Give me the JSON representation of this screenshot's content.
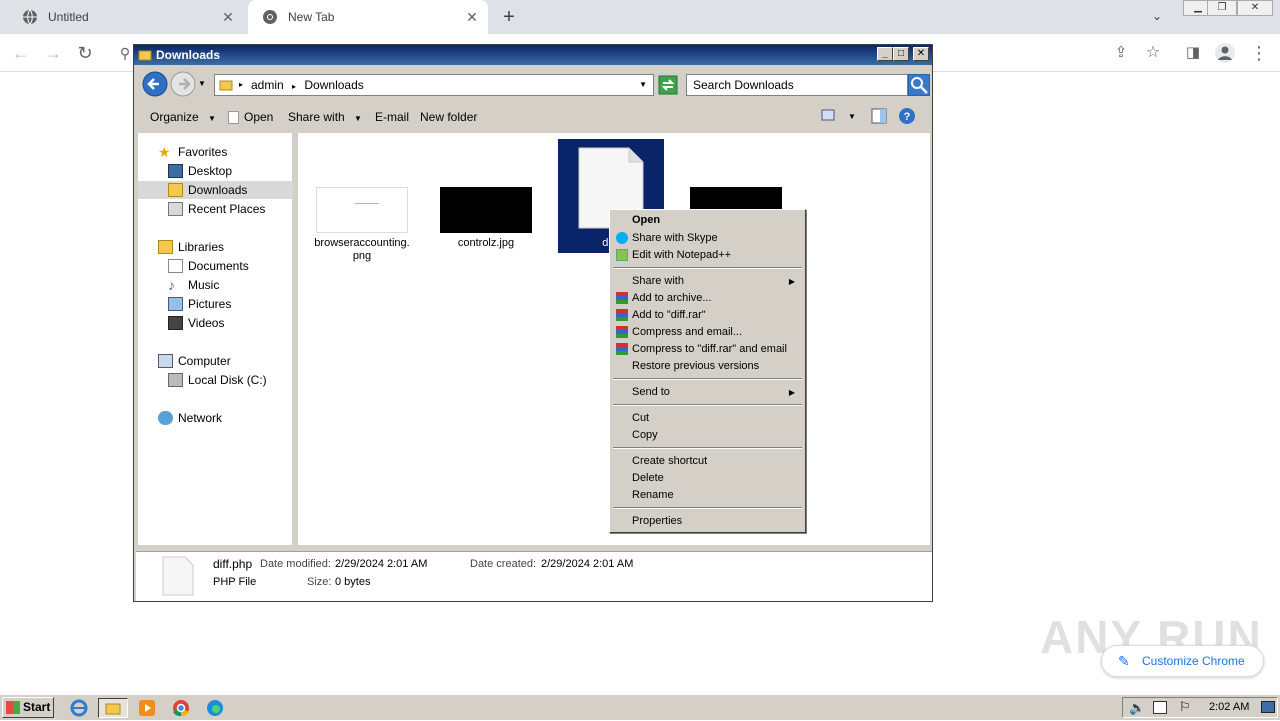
{
  "chrome": {
    "tabs": [
      {
        "title": "Untitled",
        "active": false
      },
      {
        "title": "New Tab",
        "active": true
      }
    ],
    "new_tab_symbol": "+",
    "customize_label": "Customize Chrome"
  },
  "explorer": {
    "title": "Downloads",
    "address": {
      "segments": [
        "admin",
        "Downloads"
      ]
    },
    "search_placeholder": "Search Downloads",
    "commands": {
      "organize": "Organize",
      "open": "Open",
      "share_with": "Share with",
      "email": "E-mail",
      "new_folder": "New folder"
    },
    "nav": {
      "favorites": "Favorites",
      "desktop": "Desktop",
      "downloads": "Downloads",
      "recent_places": "Recent Places",
      "libraries": "Libraries",
      "documents": "Documents",
      "music": "Music",
      "pictures": "Pictures",
      "videos": "Videos",
      "computer": "Computer",
      "local_disk": "Local Disk (C:)",
      "network": "Network"
    },
    "files": [
      {
        "name": "browseraccounting.\npng"
      },
      {
        "name": "controlz.jpg"
      },
      {
        "name": "diff."
      },
      {
        "name": ""
      }
    ],
    "details": {
      "filename": "diff.php",
      "filetype": "PHP File",
      "date_modified_label": "Date modified:",
      "date_modified": "2/29/2024 2:01 AM",
      "date_created_label": "Date created:",
      "date_created": "2/29/2024 2:01 AM",
      "size_label": "Size:",
      "size": "0 bytes"
    }
  },
  "context_menu": {
    "open": "Open",
    "share_skype": "Share with Skype",
    "edit_notepad": "Edit with Notepad++",
    "share_with": "Share with",
    "add_archive": "Add to archive...",
    "add_diff_rar": "Add to \"diff.rar\"",
    "compress_email": "Compress and email...",
    "compress_diff_email": "Compress to \"diff.rar\" and email",
    "restore": "Restore previous versions",
    "send_to": "Send to",
    "cut": "Cut",
    "copy": "Copy",
    "create_shortcut": "Create shortcut",
    "delete": "Delete",
    "rename": "Rename",
    "properties": "Properties"
  },
  "taskbar": {
    "start": "Start",
    "clock": "2:02 AM"
  },
  "watermark": "ANY RUN",
  "colors": {
    "titlebar": "#0a246a",
    "selection": "#0a246a",
    "chrome_accent": "#1a73e8"
  }
}
